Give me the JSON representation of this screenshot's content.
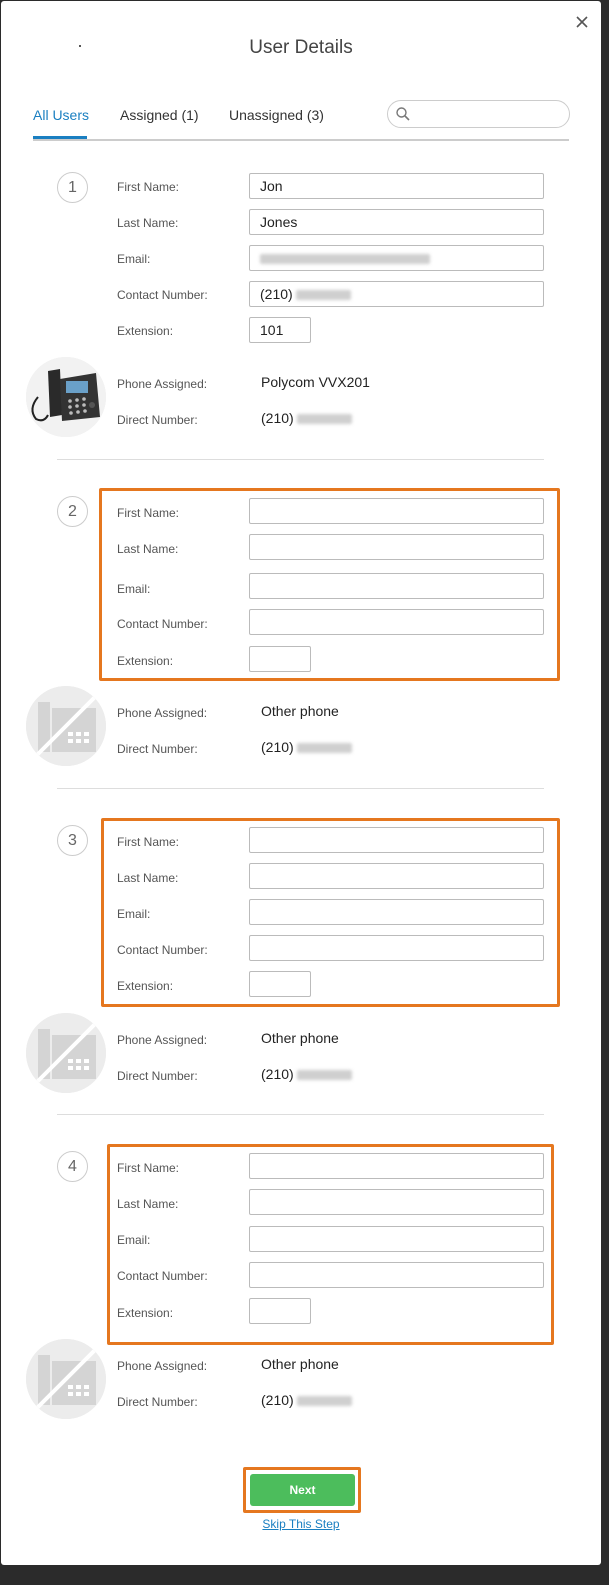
{
  "dialog": {
    "title": "User Details",
    "close_icon": "close-icon"
  },
  "tabs": [
    {
      "label": "All Users",
      "active": true
    },
    {
      "label": "Assigned (1)",
      "active": false
    },
    {
      "label": "Unassigned (3)",
      "active": false
    }
  ],
  "search": {
    "placeholder": "",
    "value": ""
  },
  "labels": {
    "first_name": "First Name:",
    "last_name": "Last Name:",
    "email": "Email:",
    "contact_number": "Contact Number:",
    "extension": "Extension:",
    "phone_assigned": "Phone Assigned:",
    "direct_number": "Direct Number:"
  },
  "users": [
    {
      "number": "1",
      "first_name": "Jon",
      "last_name": "Jones",
      "email": "",
      "contact_prefix": "(210)",
      "extension": "101",
      "phone_assigned": "Polycom VVX201",
      "phone_icon": "polycom-phone-image",
      "direct_prefix": "(210)"
    },
    {
      "number": "2",
      "first_name": "",
      "last_name": "",
      "email": "",
      "contact_prefix": "",
      "extension": "",
      "phone_assigned": "Other phone",
      "phone_icon": "no-phone-icon",
      "direct_prefix": "(210)"
    },
    {
      "number": "3",
      "first_name": "",
      "last_name": "",
      "email": "",
      "contact_prefix": "",
      "extension": "",
      "phone_assigned": "Other phone",
      "phone_icon": "no-phone-icon",
      "direct_prefix": "(210)"
    },
    {
      "number": "4",
      "first_name": "",
      "last_name": "",
      "email": "",
      "contact_prefix": "",
      "extension": "",
      "phone_assigned": "Other phone",
      "phone_icon": "no-phone-icon",
      "direct_prefix": "(210)"
    }
  ],
  "actions": {
    "next_label": "Next",
    "skip_label": "Skip This Step"
  },
  "colors": {
    "accent": "#1a7fc1",
    "highlight": "#e5771f",
    "next_button": "#4cbd5c"
  }
}
